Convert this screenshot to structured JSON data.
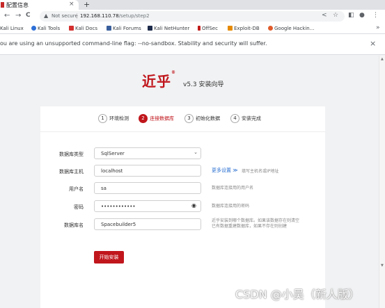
{
  "browser": {
    "tab_title": "配置信息",
    "tab_close": "×",
    "new_tab": "+",
    "security_label": "Not secure",
    "url_host": "192.168.110.78",
    "url_path": "/setup/step2",
    "bookmarks": [
      "Kali Linux",
      "Kali Tools",
      "Kali Docs",
      "Kali Forums",
      "Kali NetHunter",
      "OffSec",
      "Exploit-DB",
      "Google Hackin..."
    ],
    "bookmarks_more": "»",
    "infobar_message": "ou are using an unsupported command-line flag: --no-sandbox. Stability and security will suffer.",
    "infobar_close": "×"
  },
  "icons": {
    "back": "←",
    "forward": "→",
    "reload": "C",
    "home": "⌂",
    "warn": "▲",
    "share": "<",
    "star": "☆",
    "sidepanel": "◧",
    "profile": "●",
    "menu": "⋮",
    "caret": "⌄",
    "eye": "◉",
    "scroll_up": "▲",
    "scroll_down": "▼"
  },
  "header": {
    "logo": "近乎",
    "logo_mark": "®",
    "version": "v5.3 安装向导"
  },
  "steps": [
    {
      "num": "1",
      "label": "环境检测",
      "active": false
    },
    {
      "num": "2",
      "label": "连接数据库",
      "active": true
    },
    {
      "num": "3",
      "label": "初始化数据",
      "active": false
    },
    {
      "num": "4",
      "label": "安装完成",
      "active": false
    }
  ],
  "form": {
    "db_type_label": "数据库类型",
    "db_type_value": "SqlServer",
    "db_host_label": "数据库主机",
    "db_host_value": "localhost",
    "more_settings": "更多设置 ≫",
    "db_host_hint": "填写主机名或IP地址",
    "username_label": "用户名",
    "username_value": "sa",
    "username_hint": "数据库连接用的用户名",
    "password_label": "密码",
    "password_value": "••••••••••••",
    "password_hint": "数据库连接用的密码",
    "db_name_label": "数据库名",
    "db_name_value": "Spacebuilder5",
    "db_name_hint_1": "近乎安装到哪个数据库。如果该数据存在则清空",
    "db_name_hint_2": "已有数据重建数据库，如果不存在则创建",
    "submit_label": "开始安装"
  },
  "watermark": "CSDN @小吴（新人版）",
  "colors": {
    "accent": "#c0161c",
    "link": "#2a6fd1"
  }
}
